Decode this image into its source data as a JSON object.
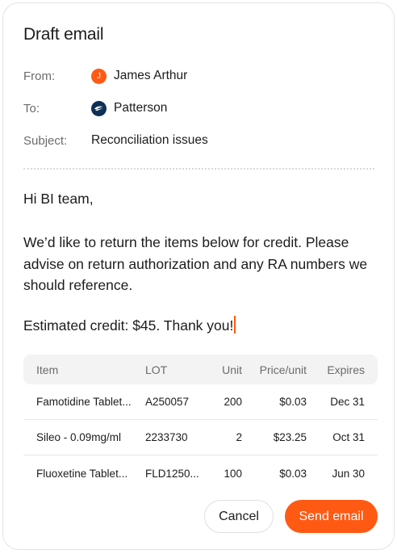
{
  "dialog": {
    "title": "Draft email"
  },
  "from": {
    "label": "From:",
    "avatar_initial": "J",
    "name": "James Arthur",
    "avatar_color": "#ff5a14"
  },
  "to": {
    "label": "To:",
    "name": "Patterson",
    "avatar_color": "#0f2f55",
    "icon": "patterson-logo-icon"
  },
  "subject": {
    "label": "Subject:",
    "value": "Reconciliation issues"
  },
  "message": {
    "greeting": "Hi BI team,",
    "paragraph": "We’d like to return the items below for credit. Please advise on return authorization and any RA numbers we should reference.",
    "closing": "Estimated credit: $45. Thank you!"
  },
  "table": {
    "headers": {
      "item": "Item",
      "lot": "LOT",
      "unit": "Unit",
      "price": "Price/unit",
      "expires": "Expires"
    },
    "rows": [
      {
        "item": "Famotidine Tablet...",
        "lot": "A250057",
        "unit": "200",
        "price": "$0.03",
        "expires": "Dec 31"
      },
      {
        "item": "Sileo - 0.09mg/ml",
        "lot": "2233730",
        "unit": "2",
        "price": "$23.25",
        "expires": "Oct 31"
      },
      {
        "item": "Fluoxetine Tablet...",
        "lot": "FLD1250...",
        "unit": "100",
        "price": "$0.03",
        "expires": "Jun 30"
      }
    ]
  },
  "actions": {
    "cancel": "Cancel",
    "send": "Send email"
  },
  "colors": {
    "accent": "#ff5a14",
    "text": "#1c1c1c",
    "muted": "#6b6b6b"
  }
}
